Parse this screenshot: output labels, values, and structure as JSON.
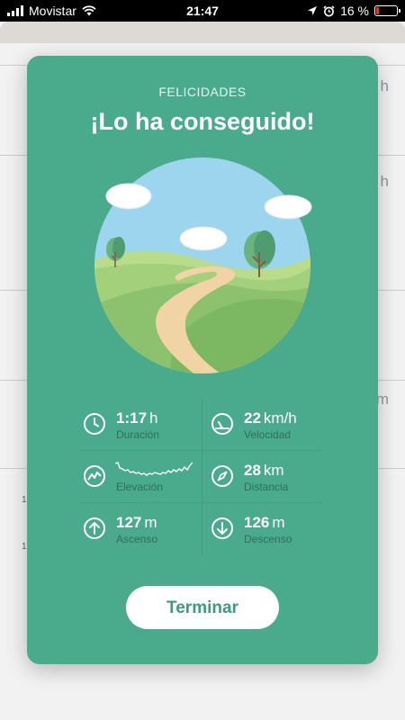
{
  "status_bar": {
    "carrier": "Movistar",
    "time": "21:47",
    "battery": "16 %",
    "battery_level": 0.16
  },
  "background_units": [
    "h",
    "h",
    "m"
  ],
  "background_labels": [
    "1",
    "1"
  ],
  "modal": {
    "kicker": "FELICIDADES",
    "title": "¡Lo ha conseguido!",
    "button_label": "Terminar"
  },
  "stats": {
    "duration": {
      "value": "1:17",
      "unit": "h",
      "label": "Duración",
      "icon": "clock-icon"
    },
    "speed": {
      "value": "22",
      "unit": "km/h",
      "label": "Velocidad",
      "icon": "speedometer-icon"
    },
    "elevation": {
      "label": "Elevación",
      "icon": "elevation-icon"
    },
    "distance": {
      "value": "28",
      "unit": "km",
      "label": "Distancia",
      "icon": "compass-icon"
    },
    "ascent": {
      "value": "127",
      "unit": "m",
      "label": "Ascenso",
      "icon": "arrow-up-icon"
    },
    "descent": {
      "value": "126",
      "unit": "m",
      "label": "Descenso",
      "icon": "arrow-down-icon"
    }
  },
  "colors": {
    "modal_bg": "#4aaa8c",
    "label": "#2e6f5c",
    "button_text": "#3f9a7c",
    "battery": "#e8352f"
  }
}
